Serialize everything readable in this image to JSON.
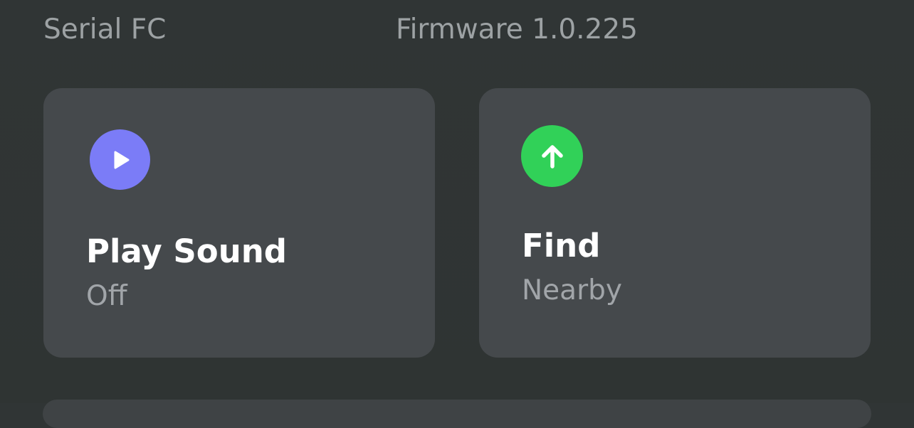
{
  "device": {
    "serial": "Serial FC",
    "firmware": "Firmware 1.0.225"
  },
  "actions": {
    "play_sound": {
      "title": "Play Sound",
      "status": "Off",
      "icon": "play-icon",
      "color": "#7b7cf7"
    },
    "find": {
      "title": "Find",
      "status": "Nearby",
      "icon": "arrow-up-icon",
      "color": "#31d158"
    }
  }
}
